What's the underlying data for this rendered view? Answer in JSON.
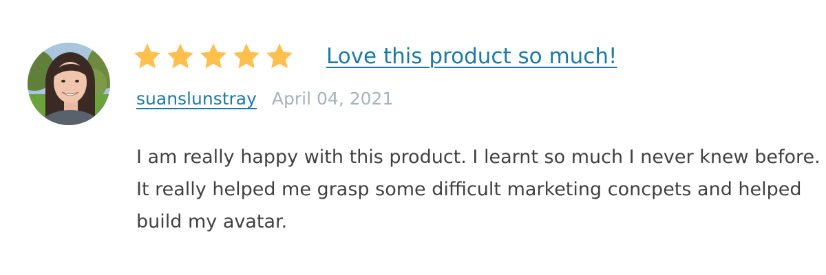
{
  "review": {
    "rating": 5,
    "rating_max": 5,
    "title": "Love this product so much!",
    "username": "suanslunstray",
    "date": "April 04, 2021",
    "body": "I am really happy with this product. I learnt so much I never knew before. It really helped me grasp some difficult marketing concpets and helped build my avatar.",
    "avatar_icon": "user-avatar-photo"
  },
  "colors": {
    "star": "#ffbf4d",
    "link": "#1b7ba6",
    "date": "#a4b3bd",
    "body_text": "#414141"
  }
}
